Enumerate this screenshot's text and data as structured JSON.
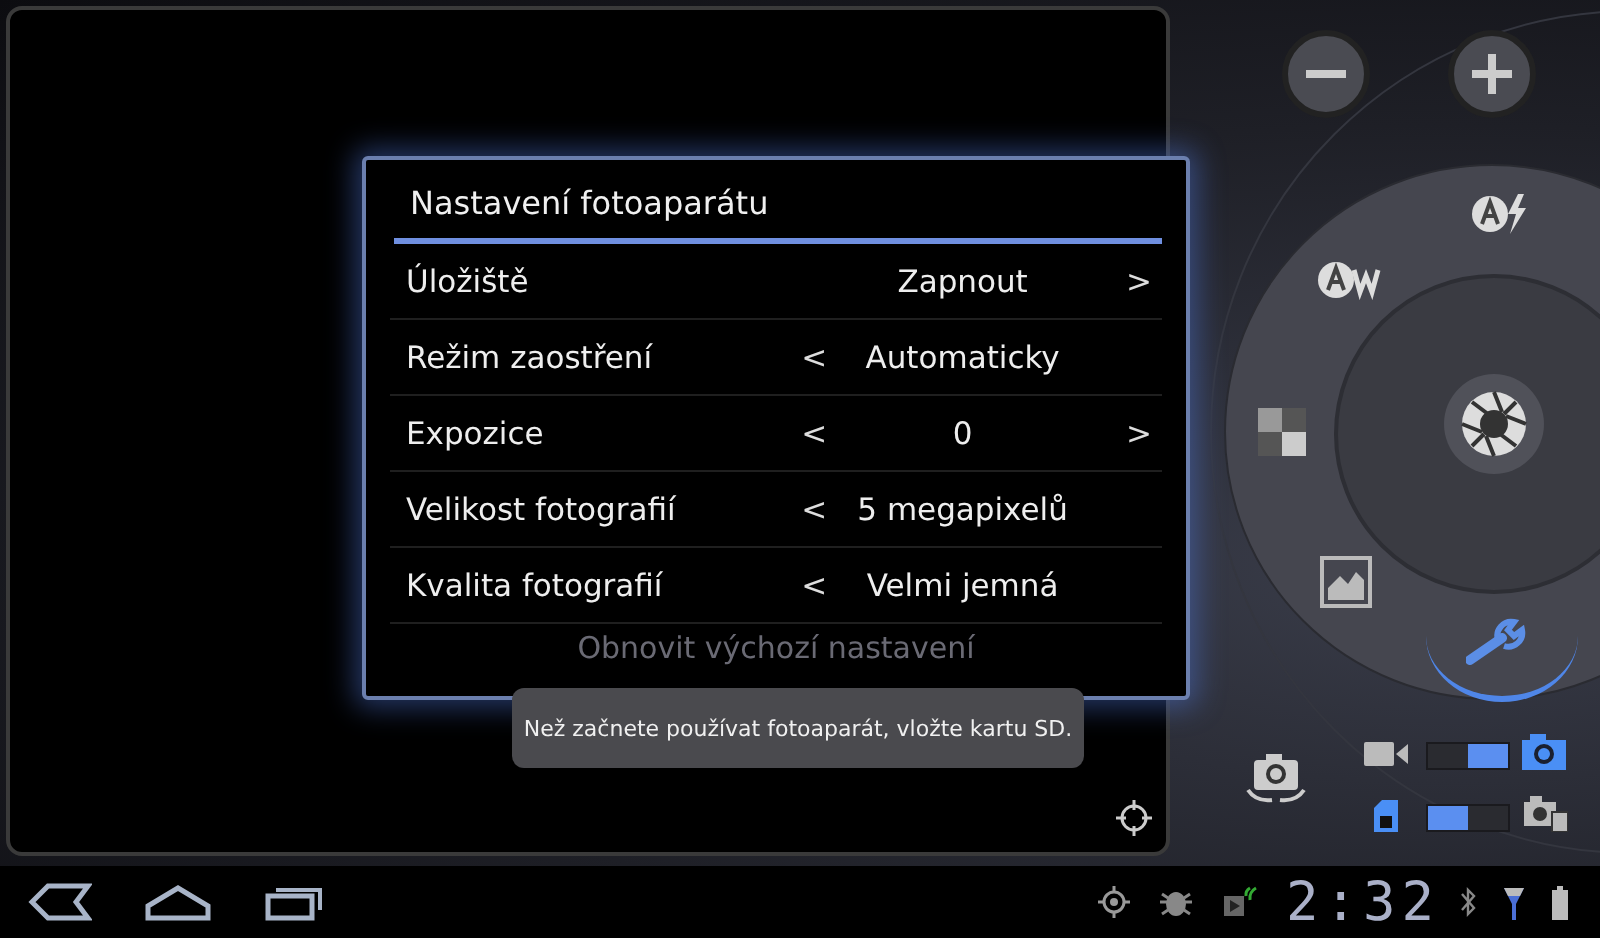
{
  "dialog": {
    "title": "Nastavení fotoaparátu",
    "rows": [
      {
        "label": "Úložiště",
        "value": "Zapnout",
        "next": ">"
      },
      {
        "label": "Režim zaostření",
        "prev": "<",
        "value": "Automaticky"
      },
      {
        "label": "Expozice",
        "prev": "<",
        "value": "0",
        "next": ">"
      },
      {
        "label": "Velikost fotografií",
        "prev": "<",
        "value": "5 megapixelů"
      },
      {
        "label": "Kvalita fotografií",
        "prev": "<",
        "value": "Velmi jemná"
      }
    ],
    "reset": "Obnovit výchozí nastavení"
  },
  "toast": "Než začnete používat fotoaparát, vložte kartu SD.",
  "mode_switch": {
    "knob_right": true
  },
  "storage_switch": {
    "knob_right": false
  },
  "status_bar": {
    "time": "2:32"
  }
}
